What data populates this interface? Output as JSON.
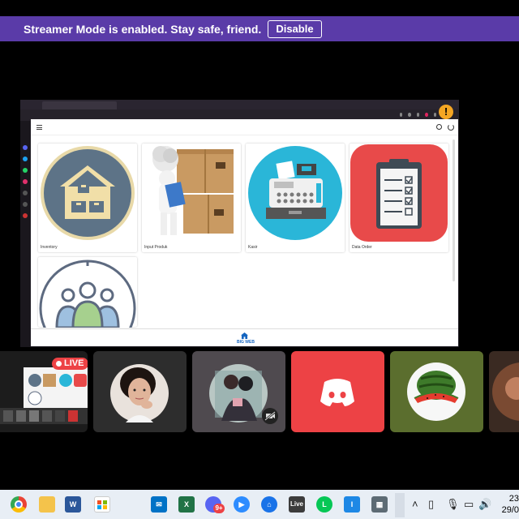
{
  "banner": {
    "message": "Streamer Mode is enabled. Stay safe, friend.",
    "button_label": "Disable",
    "color": "#5a3ba8"
  },
  "shared_screen": {
    "warning_icon": "exclamation-icon",
    "app": {
      "menu_cards": [
        {
          "label": "Inventory",
          "icon": "warehouse-icon"
        },
        {
          "label": "Input Produk",
          "icon": "boxes-person-icon"
        },
        {
          "label": "Kasir",
          "icon": "cash-register-icon"
        },
        {
          "label": "Data Order",
          "icon": "clipboard-checklist-icon"
        },
        {
          "label": "",
          "icon": "users-group-icon"
        }
      ],
      "bottom_nav": {
        "label": "BIG WEB",
        "icon": "home-icon"
      }
    }
  },
  "participants": {
    "live_badge": "LIVE",
    "tiles": [
      {
        "name": "stream-preview",
        "bg": "#1c1c1c"
      },
      {
        "name": "participant-avatar-girl",
        "bg": "#2d2d2d"
      },
      {
        "name": "participant-avatar-couple",
        "bg": "#4f4a4f"
      },
      {
        "name": "participant-discord",
        "bg": "#ed4245"
      },
      {
        "name": "participant-watermelon",
        "bg": "#5b6e2e"
      },
      {
        "name": "participant-partial",
        "bg": "#3a2a22"
      }
    ]
  },
  "taskbar": {
    "apps": [
      "chrome-icon",
      "file-explorer-icon",
      "word-icon",
      "microsoft-store-icon",
      "mail-icon",
      "excel-icon",
      "discord-icon",
      "zoom-icon",
      "chrome-remote-icon",
      "live-icon",
      "line-icon",
      "teams-icon",
      "calculator-icon"
    ],
    "discord_badge": "9+",
    "live_label": "Live",
    "clock_time": "23",
    "clock_date": "29/0"
  }
}
